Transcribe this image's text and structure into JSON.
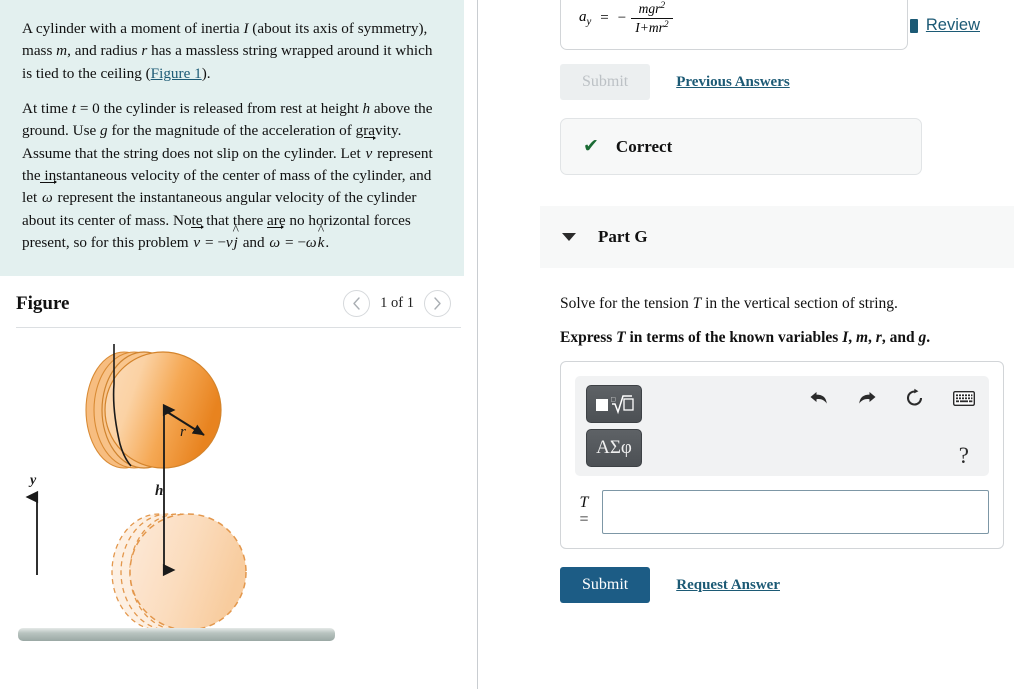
{
  "problem": {
    "paragraph1_parts": {
      "a": "A cylinder with a moment of inertia ",
      "I": "I",
      "b": " (about its axis of symmetry), mass ",
      "m": "m",
      "c": ", and radius ",
      "r": "r",
      "d": " has a massless string wrapped around it which is tied to the ceiling (",
      "figure_link": "Figure 1",
      "e": ")."
    },
    "paragraph2_parts": {
      "a": "At time ",
      "t": "t",
      "b": " = 0 the cylinder is released from rest at height ",
      "h": "h",
      "c": " above the ground. Use ",
      "g": "g",
      "d": " for the magnitude of the acceleration of gravity. Assume that the string does not slip on the cylinder. Let ",
      "v": "v",
      "e": " represent the instantaneous velocity of the center of mass of the cylinder, and let ",
      "omega": "ω",
      "f": " represent the instantaneous angular velocity of the cylinder about its center of mass. Note that there are no horizontal forces present, so for this problem ",
      "v2": "v",
      "g2": " = −",
      "v3": "v",
      "jhat": "j",
      "h2": " and ",
      "omega2": "ω",
      "i": " = −",
      "omega3": "ω",
      "khat": "k",
      "j": "."
    }
  },
  "figure": {
    "title": "Figure",
    "count_label": "1 of 1",
    "prev_icon": "chevron-left-icon",
    "next_icon": "chevron-right-icon",
    "labels": {
      "radius": "r",
      "height": "h",
      "axis": "y"
    },
    "colors": {
      "cylinder_light": "#fbd9b4",
      "cylinder_mid": "#f7a94f",
      "cylinder_dark": "#e8831f",
      "ghost_outline": "#e3974c",
      "ground_top": "#d6dcd9",
      "ground_bottom": "#9aa8a4"
    }
  },
  "review": {
    "label": "Review",
    "icon": "book-icon",
    "color": "#1c5a75"
  },
  "previous_part": {
    "equation": {
      "lhs_var": "a",
      "lhs_sub": "y",
      "equals": "=",
      "minus": "−",
      "numerator": "mgr",
      "numerator_sup": "2",
      "denominator": "I+mr",
      "denominator_sup": "2"
    },
    "submit_label": "Submit",
    "previous_answers_label": "Previous Answers",
    "feedback": {
      "icon": "check-icon",
      "text": "Correct",
      "color": "#1b6b34"
    }
  },
  "part": {
    "caret_icon": "caret-down-icon",
    "title": "Part G",
    "prompt_parts": {
      "a": "Solve for the tension ",
      "T": "T",
      "b": " in the vertical section of string."
    },
    "instruction_parts": {
      "a": "Express ",
      "T": "T",
      "b": " in terms of the known variables ",
      "I": "I",
      "c": ", ",
      "m": "m",
      "d": ", ",
      "r": "r",
      "e": ", and ",
      "g": "g",
      "f": "."
    },
    "toolbar": {
      "template_button": "template-sqrt-icon",
      "greek_button": "ΑΣφ",
      "undo_icon": "undo-icon",
      "redo_icon": "redo-icon",
      "reset_icon": "reset-icon",
      "keyboard_icon": "keyboard-icon",
      "help_label": "?"
    },
    "input": {
      "label_var": "T",
      "label_equals": "=",
      "value": "",
      "placeholder": ""
    },
    "submit_label": "Submit",
    "request_answer_label": "Request Answer"
  },
  "theme": {
    "problem_bg": "#e3f0ef",
    "link": "#1c5a75",
    "primary_button": "#1c5c85",
    "panel_bg": "#f7f8f8"
  }
}
